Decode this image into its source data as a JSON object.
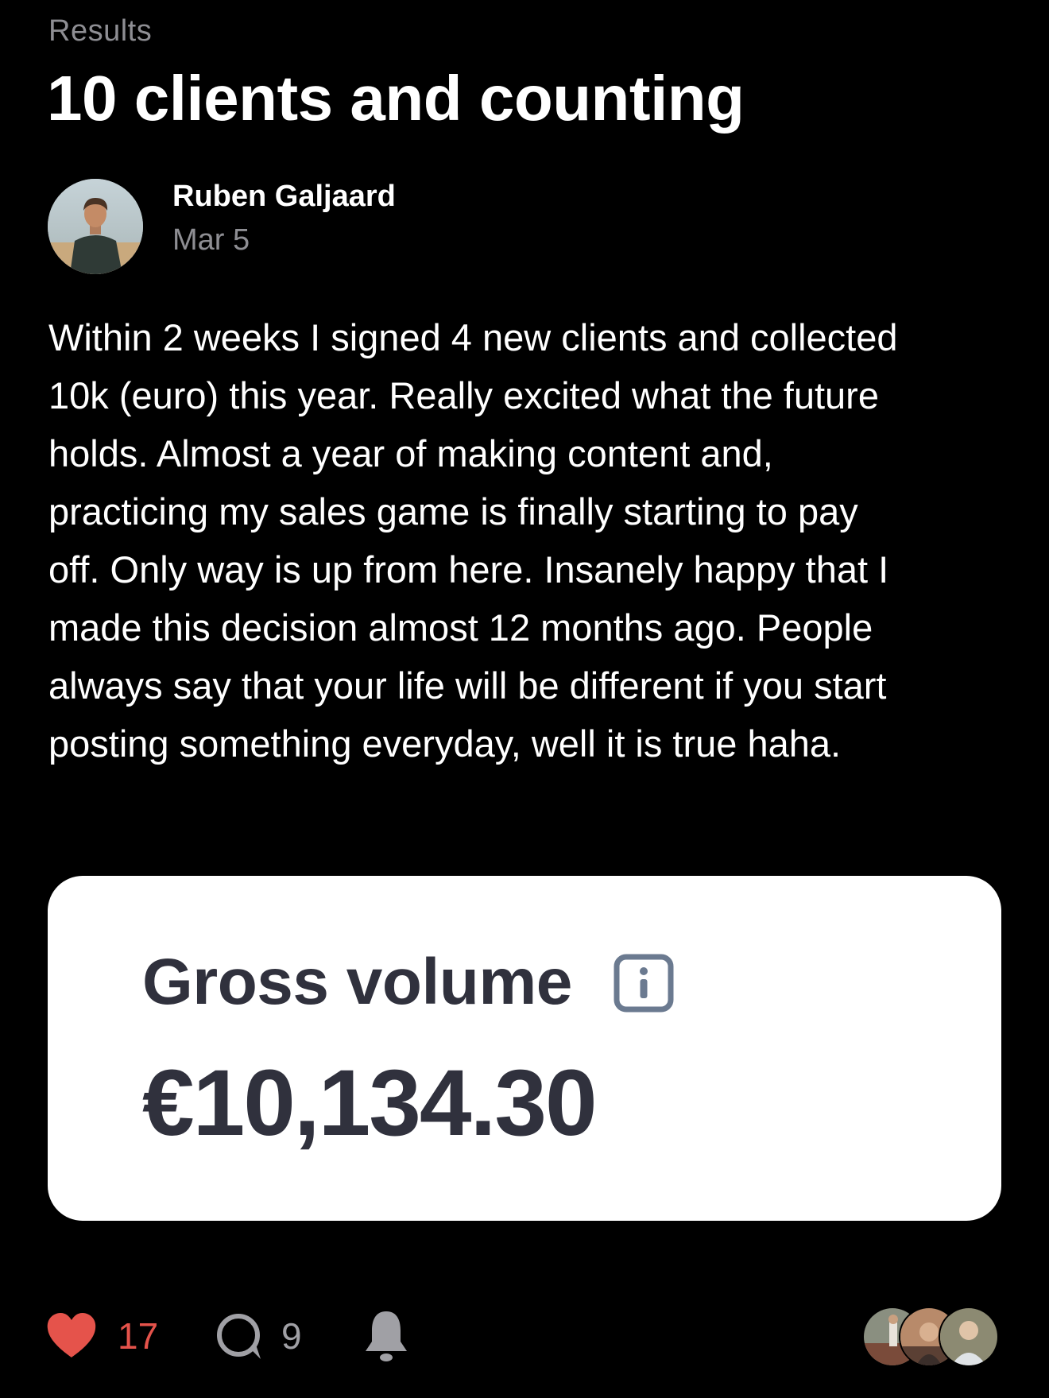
{
  "post": {
    "category": "Results",
    "title": "10 clients and counting",
    "author": {
      "name": "Ruben Galjaard",
      "date": "Mar 5"
    },
    "body_lines": [
      "Within 2 weeks I signed 4 new clients and collected",
      "10k (euro) this year. Really excited what the future",
      "holds. Almost a year of making content and,",
      "practicing my sales game is finally starting to pay",
      "off. Only way is up from here. Insanely happy that I",
      "made this decision almost 12 months ago. People",
      "always say that your life will be different if you start",
      "posting something everyday, well it is true haha."
    ],
    "attachment": {
      "label": "Gross volume",
      "value": "€10,134.30"
    }
  },
  "actions": {
    "likes": "17",
    "comments": "9"
  },
  "colors": {
    "background": "#000000",
    "like_accent": "#e5534b",
    "muted_text": "#8e8e93",
    "card_text": "#30313d"
  },
  "icons": [
    "heart-icon",
    "comment-icon",
    "bell-icon",
    "info-icon"
  ]
}
